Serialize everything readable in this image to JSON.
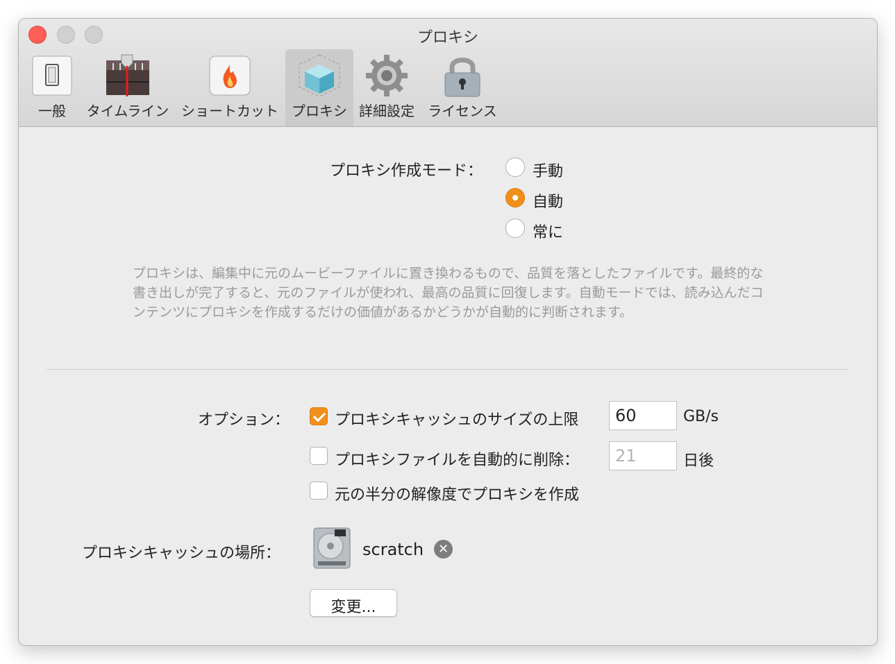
{
  "window": {
    "title": "プロキシ"
  },
  "toolbar": {
    "items": [
      {
        "label": "一般",
        "icon": "switch-icon"
      },
      {
        "label": "タイムライン",
        "icon": "timeline-icon"
      },
      {
        "label": "ショートカット",
        "icon": "flame-icon"
      },
      {
        "label": "プロキシ",
        "icon": "cube-icon",
        "selected": true
      },
      {
        "label": "詳細設定",
        "icon": "gear-icon"
      },
      {
        "label": "ライセンス",
        "icon": "lock-icon"
      }
    ]
  },
  "mode": {
    "label": "プロキシ作成モード：",
    "options": [
      "手動",
      "自動",
      "常に"
    ],
    "selected": "自動"
  },
  "description": "プロキシは、編集中に元のムービーファイルに置き換わるもので、品質を落としたファイルです。最終的な書き出しが完了すると、元のファイルが使われ、最高の品質に回復します。自動モードでは、読み込んだコンテンツにプロキシを作成するだけの価値があるかどうかが自動的に判断されます。",
  "options": {
    "label": "オプション：",
    "cache_limit": {
      "label": "プロキシキャッシュのサイズの上限",
      "checked": true,
      "value": "60",
      "unit": "GB/s"
    },
    "auto_delete": {
      "label": "プロキシファイルを自動的に削除：",
      "checked": false,
      "value": "21",
      "unit": "日後"
    },
    "half_res": {
      "label": "元の半分の解像度でプロキシを作成",
      "checked": false
    }
  },
  "location": {
    "label": "プロキシキャッシュの場所：",
    "disk_name": "scratch",
    "disk_icon": "hard-drive-icon",
    "change_button": "変更..."
  },
  "colors": {
    "accent": "#f0901a",
    "close": "#fe5f57"
  }
}
